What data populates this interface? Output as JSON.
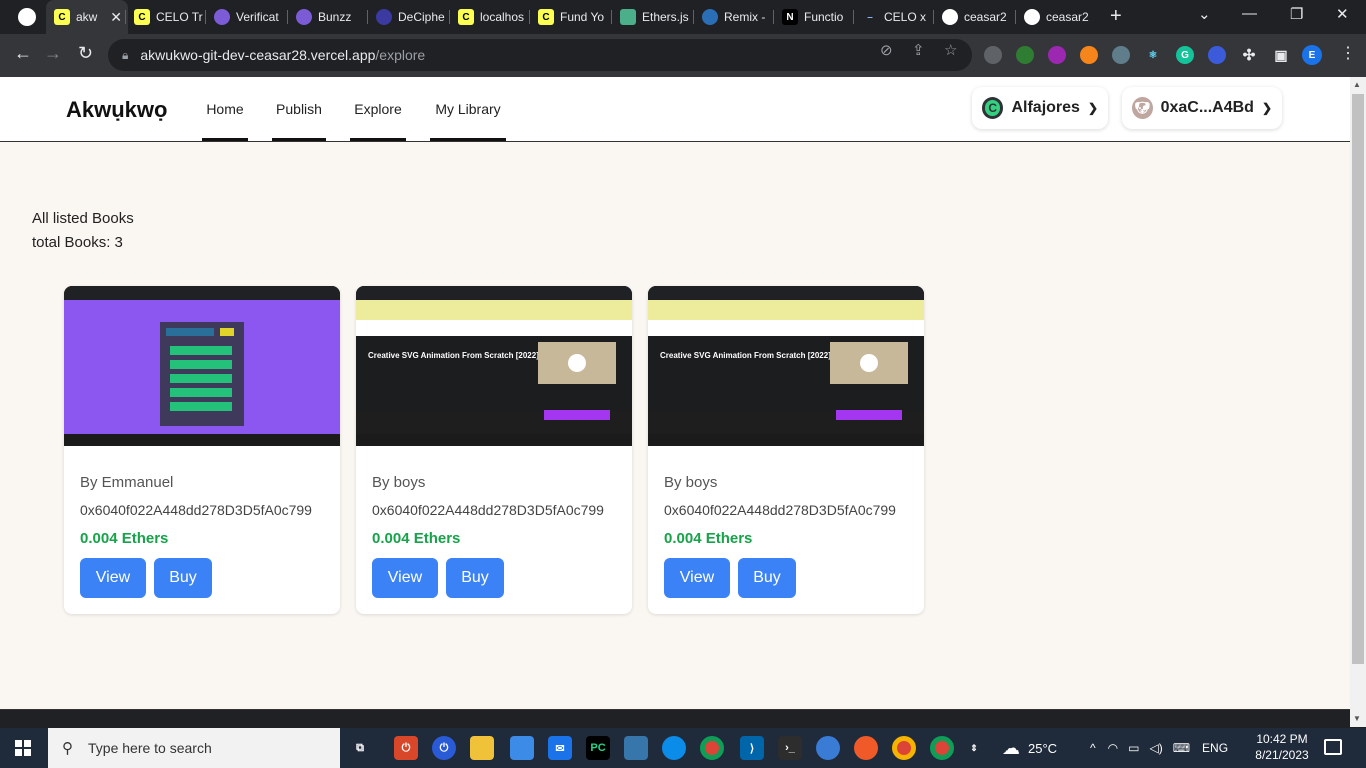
{
  "browser": {
    "tabs": [
      {
        "label": "akw",
        "fav": "celo",
        "icon": "celo-icon"
      },
      {
        "label": "CELO Tr",
        "fav": "celo",
        "icon": "celo-icon"
      },
      {
        "label": "Verificat",
        "fav": "purple",
        "icon": "globe-icon"
      },
      {
        "label": "Bunzz",
        "fav": "purple",
        "icon": "bunzz-icon"
      },
      {
        "label": "DeCiphe",
        "fav": "dec",
        "icon": "decipher-icon"
      },
      {
        "label": "localhos",
        "fav": "celo",
        "icon": "celo-icon"
      },
      {
        "label": "Fund Yo",
        "fav": "celo",
        "icon": "celo-icon"
      },
      {
        "label": "Ethers.js",
        "fav": "eth",
        "icon": "ethers-icon"
      },
      {
        "label": "Remix -",
        "fav": "remix",
        "icon": "remix-icon"
      },
      {
        "label": "Functio",
        "fav": "notion",
        "icon": "notion-icon"
      },
      {
        "label": "CELO x",
        "fav": "dash",
        "icon": "dash-icon"
      },
      {
        "label": "ceasar2",
        "fav": "gh",
        "icon": "github-icon"
      },
      {
        "label": "ceasar2",
        "fav": "gh",
        "icon": "github-icon"
      }
    ],
    "url_host": "akwukwo-git-dev-ceasar28.vercel.app",
    "url_path": "/explore",
    "profile_initial": "E"
  },
  "site": {
    "brand": "Akwụkwọ",
    "nav": [
      "Home",
      "Publish",
      "Explore",
      "My Library"
    ],
    "network": "Alfajores",
    "network_icon_letter": "C",
    "wallet": "0xaC...A4Bd"
  },
  "listing": {
    "heading": "All listed Books",
    "total": "total Books: 3"
  },
  "books": [
    {
      "author": "By Emmanuel",
      "address": "0x6040f022A448dd278D3D5fA0c799",
      "price": "0.004 Ethers",
      "view_label": "View",
      "buy_label": "Buy",
      "thumb_style": "purple"
    },
    {
      "author": "By boys",
      "address": "0x6040f022A448dd278D3D5fA0c799",
      "price": "0.004 Ethers",
      "view_label": "View",
      "buy_label": "Buy",
      "thumb_style": "udemy",
      "thumb_title": "Creative SVG Animation From Scratch [2022]"
    },
    {
      "author": "By boys",
      "address": "0x6040f022A448dd278D3D5fA0c799",
      "price": "0.004 Ethers",
      "view_label": "View",
      "buy_label": "Buy",
      "thumb_style": "udemy",
      "thumb_title": "Creative SVG Animation From Scratch [2022]"
    }
  ],
  "taskbar": {
    "search_placeholder": "Type here to search",
    "weather": "25°C",
    "language": "ENG",
    "time": "10:42 PM",
    "date": "8/21/2023"
  },
  "colors": {
    "primary_button": "#3b82f6",
    "price_green": "#16a34a",
    "page_bg": "#faf6f1"
  }
}
